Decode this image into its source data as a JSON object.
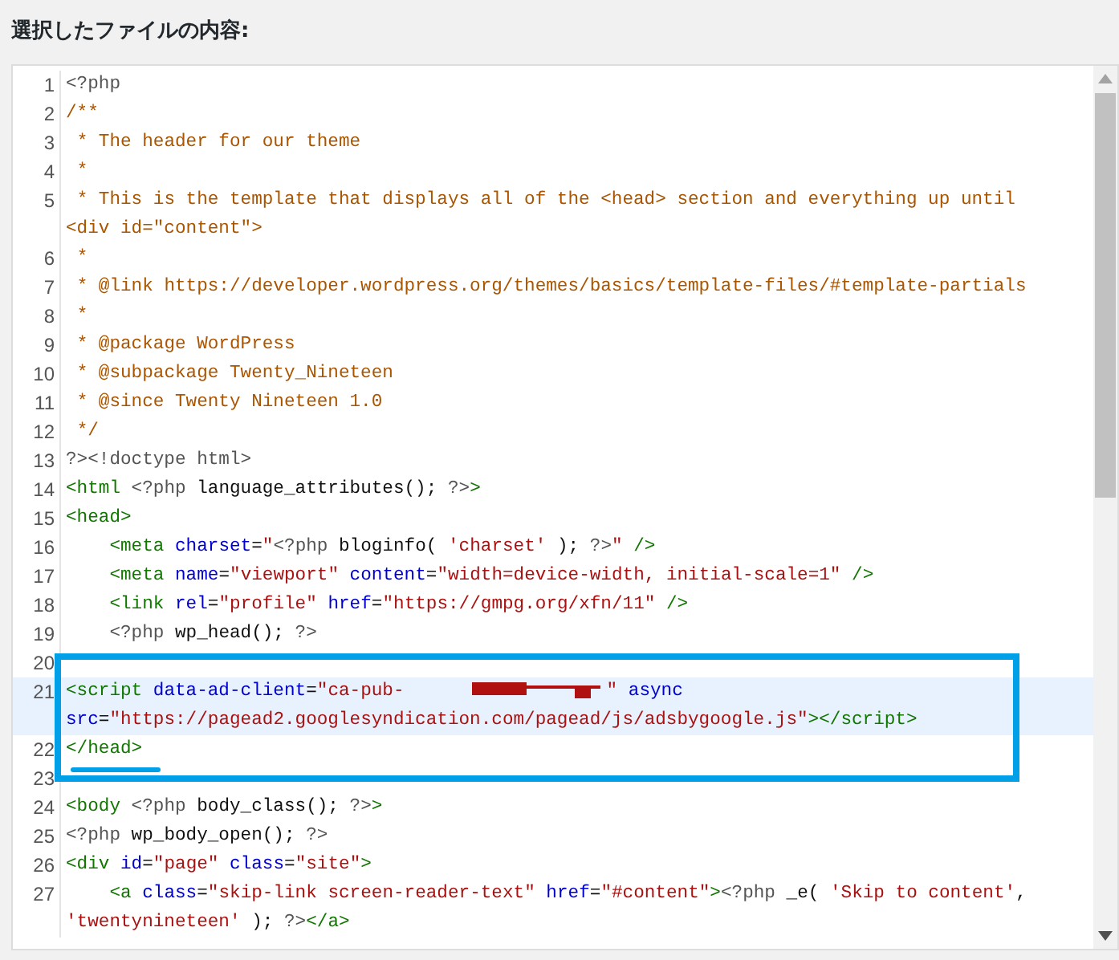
{
  "heading": "選択したファイルの内容:",
  "editor": {
    "lines": [
      {
        "number": "1",
        "highlighted": false,
        "tokens": [
          {
            "kind": "php",
            "text": "<?php"
          }
        ]
      },
      {
        "number": "2",
        "highlighted": false,
        "tokens": [
          {
            "kind": "comment",
            "text": "/**"
          }
        ]
      },
      {
        "number": "3",
        "highlighted": false,
        "tokens": [
          {
            "kind": "comment",
            "text": " * The header for our theme"
          }
        ]
      },
      {
        "number": "4",
        "highlighted": false,
        "tokens": [
          {
            "kind": "comment",
            "text": " *"
          }
        ]
      },
      {
        "number": "5",
        "highlighted": false,
        "tokens": [
          {
            "kind": "comment",
            "text": " * This is the template that displays all of the <head> section and everything up until <div id=\"content\">"
          }
        ]
      },
      {
        "number": "6",
        "highlighted": false,
        "tokens": [
          {
            "kind": "comment",
            "text": " *"
          }
        ]
      },
      {
        "number": "7",
        "highlighted": false,
        "tokens": [
          {
            "kind": "comment",
            "text": " * @link https://developer.wordpress.org/themes/basics/template-files/#template-partials"
          }
        ]
      },
      {
        "number": "8",
        "highlighted": false,
        "tokens": [
          {
            "kind": "comment",
            "text": " *"
          }
        ]
      },
      {
        "number": "9",
        "highlighted": false,
        "tokens": [
          {
            "kind": "comment",
            "text": " * @package WordPress"
          }
        ]
      },
      {
        "number": "10",
        "highlighted": false,
        "tokens": [
          {
            "kind": "comment",
            "text": " * @subpackage Twenty_Nineteen"
          }
        ]
      },
      {
        "number": "11",
        "highlighted": false,
        "tokens": [
          {
            "kind": "comment",
            "text": " * @since Twenty Nineteen 1.0"
          }
        ]
      },
      {
        "number": "12",
        "highlighted": false,
        "tokens": [
          {
            "kind": "comment",
            "text": " */"
          }
        ]
      },
      {
        "number": "13",
        "highlighted": false,
        "tokens": [
          {
            "kind": "php",
            "text": "?><!doctype html>"
          }
        ]
      },
      {
        "number": "14",
        "highlighted": false,
        "tokens": [
          {
            "kind": "tag",
            "text": "<html"
          },
          {
            "kind": "php",
            "text": " <?php"
          },
          {
            "kind": "plain",
            "text": " language_attributes(); "
          },
          {
            "kind": "php",
            "text": "?>"
          },
          {
            "kind": "tag",
            "text": ">"
          }
        ]
      },
      {
        "number": "15",
        "highlighted": false,
        "tokens": [
          {
            "kind": "tag",
            "text": "<head>"
          }
        ]
      },
      {
        "number": "16",
        "highlighted": false,
        "tokens": [
          {
            "kind": "tag",
            "text": "    <meta"
          },
          {
            "kind": "attr",
            "text": " charset"
          },
          {
            "kind": "plain",
            "text": "="
          },
          {
            "kind": "string",
            "text": "\""
          },
          {
            "kind": "php",
            "text": "<?php"
          },
          {
            "kind": "plain",
            "text": " bloginfo( "
          },
          {
            "kind": "string",
            "text": "'charset'"
          },
          {
            "kind": "plain",
            "text": " ); "
          },
          {
            "kind": "php",
            "text": "?>"
          },
          {
            "kind": "string",
            "text": "\""
          },
          {
            "kind": "tag",
            "text": " />"
          }
        ]
      },
      {
        "number": "17",
        "highlighted": false,
        "tokens": [
          {
            "kind": "tag",
            "text": "    <meta"
          },
          {
            "kind": "attr",
            "text": " name"
          },
          {
            "kind": "plain",
            "text": "="
          },
          {
            "kind": "string",
            "text": "\"viewport\""
          },
          {
            "kind": "attr",
            "text": " content"
          },
          {
            "kind": "plain",
            "text": "="
          },
          {
            "kind": "string",
            "text": "\"width=device-width, initial-scale=1\""
          },
          {
            "kind": "tag",
            "text": " />"
          }
        ]
      },
      {
        "number": "18",
        "highlighted": false,
        "tokens": [
          {
            "kind": "tag",
            "text": "    <link"
          },
          {
            "kind": "attr",
            "text": " rel"
          },
          {
            "kind": "plain",
            "text": "="
          },
          {
            "kind": "string",
            "text": "\"profile\""
          },
          {
            "kind": "attr",
            "text": " href"
          },
          {
            "kind": "plain",
            "text": "="
          },
          {
            "kind": "string",
            "text": "\"https://gmpg.org/xfn/11\""
          },
          {
            "kind": "tag",
            "text": " />"
          }
        ]
      },
      {
        "number": "19",
        "highlighted": false,
        "tokens": [
          {
            "kind": "php",
            "text": "    <?php"
          },
          {
            "kind": "plain",
            "text": " wp_head(); "
          },
          {
            "kind": "php",
            "text": "?>"
          }
        ]
      },
      {
        "number": "20",
        "highlighted": false
      },
      {
        "number": "21",
        "highlighted": true,
        "tokens": [
          {
            "kind": "tag",
            "text": "<script"
          },
          {
            "kind": "attr",
            "text": " data-ad-client"
          },
          {
            "kind": "plain",
            "text": "="
          },
          {
            "kind": "string",
            "text": "\"ca-pub-"
          },
          {
            "kind": "redacted"
          },
          {
            "kind": "string",
            "text": "\""
          },
          {
            "kind": "attr",
            "text": " async"
          },
          {
            "kind": "attr",
            "text": " src"
          },
          {
            "kind": "plain",
            "text": "="
          },
          {
            "kind": "string",
            "text": "\"https://pagead2.googlesyndication.com/pagead/js/adsbygoogle.js\""
          },
          {
            "kind": "tag",
            "text": "></script>"
          }
        ]
      },
      {
        "number": "22",
        "highlighted": false,
        "tokens": [
          {
            "kind": "tag",
            "text": "</head>"
          }
        ]
      },
      {
        "number": "23",
        "highlighted": false
      },
      {
        "number": "24",
        "highlighted": false,
        "tokens": [
          {
            "kind": "tag",
            "text": "<body"
          },
          {
            "kind": "php",
            "text": " <?php"
          },
          {
            "kind": "plain",
            "text": " body_class(); "
          },
          {
            "kind": "php",
            "text": "?>"
          },
          {
            "kind": "tag",
            "text": ">"
          }
        ]
      },
      {
        "number": "25",
        "highlighted": false,
        "tokens": [
          {
            "kind": "php",
            "text": "<?php"
          },
          {
            "kind": "plain",
            "text": " wp_body_open(); "
          },
          {
            "kind": "php",
            "text": "?>"
          }
        ]
      },
      {
        "number": "26",
        "highlighted": false,
        "tokens": [
          {
            "kind": "tag",
            "text": "<div"
          },
          {
            "kind": "attr",
            "text": " id"
          },
          {
            "kind": "plain",
            "text": "="
          },
          {
            "kind": "string",
            "text": "\"page\""
          },
          {
            "kind": "attr",
            "text": " class"
          },
          {
            "kind": "plain",
            "text": "="
          },
          {
            "kind": "string",
            "text": "\"site\""
          },
          {
            "kind": "tag",
            "text": ">"
          }
        ]
      },
      {
        "number": "27",
        "highlighted": false,
        "tokens": [
          {
            "kind": "tag",
            "text": "    <a"
          },
          {
            "kind": "attr",
            "text": " class"
          },
          {
            "kind": "plain",
            "text": "="
          },
          {
            "kind": "string",
            "text": "\"skip-link screen-reader-text\""
          },
          {
            "kind": "attr",
            "text": " href"
          },
          {
            "kind": "plain",
            "text": "="
          },
          {
            "kind": "string",
            "text": "\"#content\""
          },
          {
            "kind": "tag",
            "text": ">"
          },
          {
            "kind": "php",
            "text": "<?php"
          },
          {
            "kind": "plain",
            "text": " _e( "
          },
          {
            "kind": "string",
            "text": "'Skip to content'"
          },
          {
            "kind": "plain",
            "text": ", "
          },
          {
            "kind": "string",
            "text": "'twentynineteen'"
          },
          {
            "kind": "plain",
            "text": " ); "
          },
          {
            "kind": "php",
            "text": "?>"
          },
          {
            "kind": "tag",
            "text": "</a>"
          }
        ]
      }
    ]
  }
}
